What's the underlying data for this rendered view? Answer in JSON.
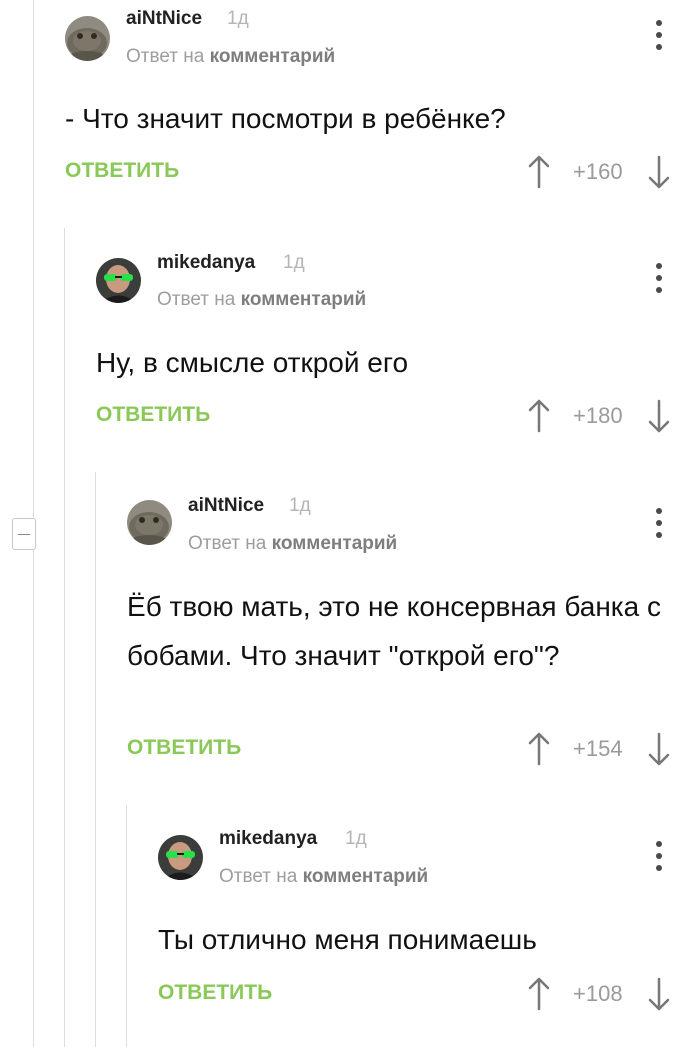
{
  "comments": [
    {
      "username": "aiNtNice",
      "time": "1д",
      "reply_prefix": "Ответ на",
      "reply_target": "комментарий",
      "text": "- Что значит посмотри в ребёнке?",
      "reply_label": "ОТВЕТИТЬ",
      "rating": "+160",
      "avatar": "toad-avatar-icon"
    },
    {
      "username": "mikedanya",
      "time": "1д",
      "reply_prefix": "Ответ на",
      "reply_target": "комментарий",
      "text": "Ну, в смысле открой его",
      "reply_label": "ОТВЕТИТЬ",
      "rating": "+180",
      "avatar": "man-green-glasses-avatar-icon"
    },
    {
      "username": "aiNtNice",
      "time": "1д",
      "reply_prefix": "Ответ на",
      "reply_target": "комментарий",
      "text": "Ёб твою мать, это не консервная банка с бобами. Что значит \"открой его\"?",
      "reply_label": "ОТВЕТИТЬ",
      "rating": "+154",
      "avatar": "toad-avatar-icon"
    },
    {
      "username": "mikedanya",
      "time": "1д",
      "reply_prefix": "Ответ на",
      "reply_target": "комментарий",
      "text": "Ты отлично меня понимаешь",
      "reply_label": "ОТВЕТИТЬ",
      "rating": "+108",
      "avatar": "man-green-glasses-avatar-icon"
    }
  ],
  "colors": {
    "accent": "#8ac858",
    "meta": "#9d9d9d",
    "thread_line": "#dcdcdc"
  },
  "icons": {
    "collapse": "minus-icon",
    "more": "vertical-dots-icon",
    "upvote": "arrow-up-icon",
    "downvote": "arrow-down-icon"
  }
}
